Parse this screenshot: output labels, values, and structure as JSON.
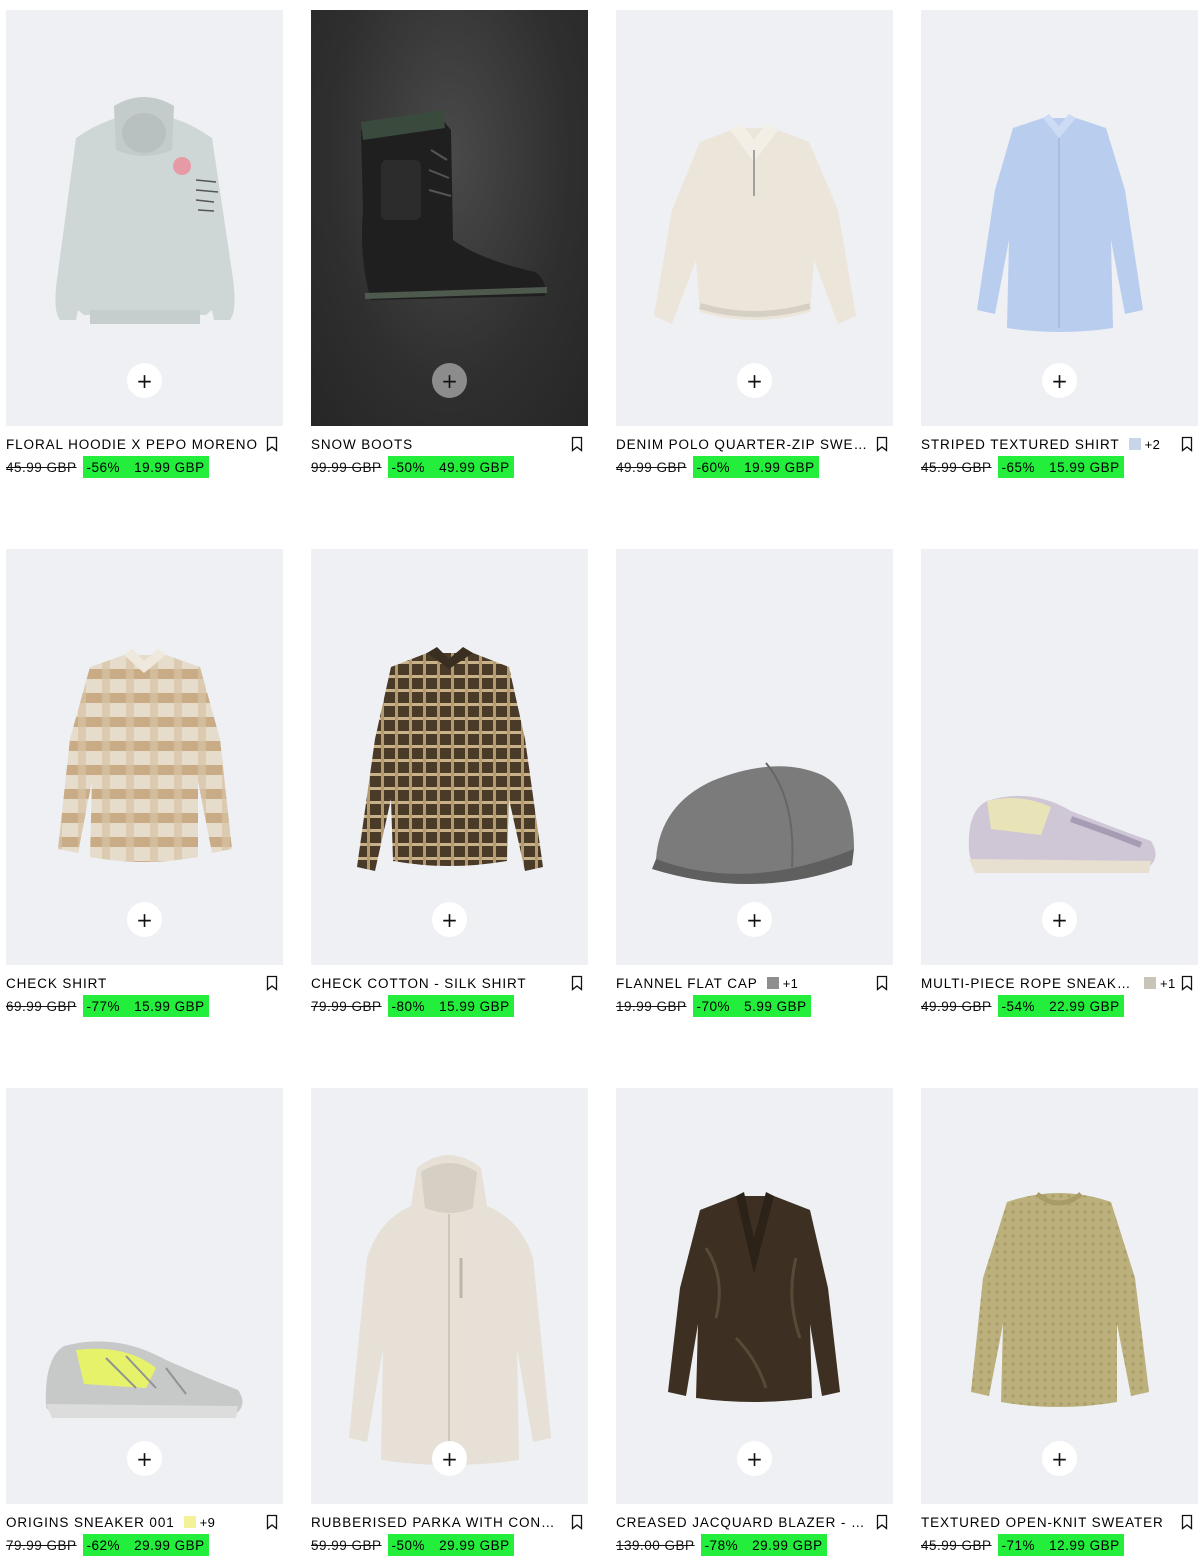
{
  "products": [
    {
      "name": "FLORAL HOODIE X PEPO MORENO",
      "old_price": "45.99 GBP",
      "discount": "-56%",
      "price": "19.99 GBP",
      "swatch_color": null,
      "more_colors": null,
      "art": "hoodie"
    },
    {
      "name": "SNOW BOOTS",
      "old_price": "99.99 GBP",
      "discount": "-50%",
      "price": "49.99 GBP",
      "swatch_color": null,
      "more_colors": null,
      "art": "boot"
    },
    {
      "name": "DENIM POLO QUARTER-ZIP SWEATSHIRT",
      "old_price": "49.99 GBP",
      "discount": "-60%",
      "price": "19.99 GBP",
      "swatch_color": null,
      "more_colors": null,
      "art": "polo"
    },
    {
      "name": "STRIPED TEXTURED SHIRT",
      "old_price": "45.99 GBP",
      "discount": "-65%",
      "price": "15.99 GBP",
      "swatch_color": "#c9d5ea",
      "more_colors": "+2",
      "art": "blue-shirt"
    },
    {
      "name": "CHECK SHIRT",
      "old_price": "69.99 GBP",
      "discount": "-77%",
      "price": "15.99 GBP",
      "swatch_color": null,
      "more_colors": null,
      "art": "check-shirt"
    },
    {
      "name": "CHECK COTTON - SILK SHIRT",
      "old_price": "79.99 GBP",
      "discount": "-80%",
      "price": "15.99 GBP",
      "swatch_color": null,
      "more_colors": null,
      "art": "silk-shirt"
    },
    {
      "name": "FLANNEL FLAT CAP",
      "old_price": "19.99 GBP",
      "discount": "-70%",
      "price": "5.99 GBP",
      "swatch_color": "#8e8e8e",
      "more_colors": "+1",
      "art": "cap"
    },
    {
      "name": "MULTI-PIECE ROPE SNEAKERS",
      "old_price": "49.99 GBP",
      "discount": "-54%",
      "price": "22.99 GBP",
      "swatch_color": "#c9c4b8",
      "more_colors": "+1",
      "art": "rope-sneaker"
    },
    {
      "name": "ORIGINS SNEAKER 001",
      "old_price": "79.99 GBP",
      "discount": "-62%",
      "price": "29.99 GBP",
      "swatch_color": "#f3f29a",
      "more_colors": "+9",
      "art": "origins-sneaker"
    },
    {
      "name": "RUBBERISED PARKA WITH CONTRAST",
      "old_price": "59.99 GBP",
      "discount": "-50%",
      "price": "29.99 GBP",
      "swatch_color": null,
      "more_colors": null,
      "art": "parka"
    },
    {
      "name": "CREASED JACQUARD BLAZER - LIMITED",
      "old_price": "139.00 GBP",
      "discount": "-78%",
      "price": "29.99 GBP",
      "swatch_color": null,
      "more_colors": null,
      "art": "blazer"
    },
    {
      "name": "TEXTURED OPEN-KNIT SWEATER",
      "old_price": "45.99 GBP",
      "discount": "-71%",
      "price": "12.99 GBP",
      "swatch_color": null,
      "more_colors": null,
      "art": "sweater"
    }
  ],
  "icons": {
    "add": "plus-icon",
    "save": "bookmark-icon"
  },
  "add_glyph": "+",
  "colors": {
    "sale_highlight": "#22ee3b",
    "image_background": "#eef0f3"
  }
}
